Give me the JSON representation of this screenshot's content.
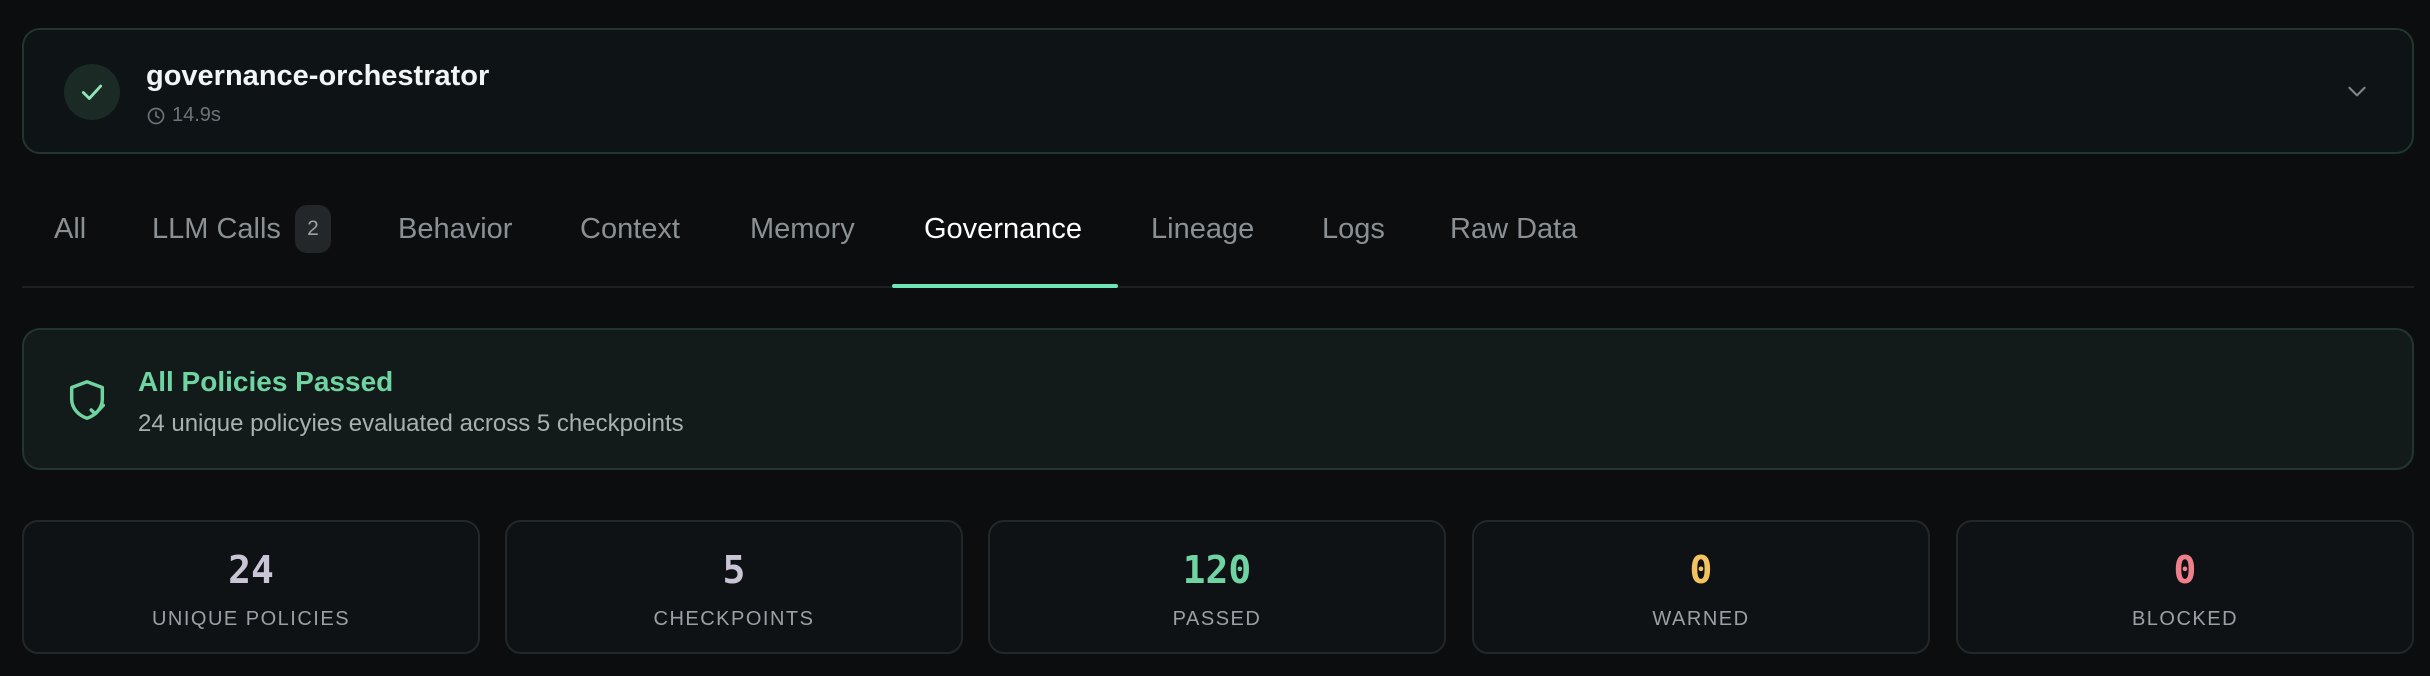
{
  "run": {
    "name": "governance-orchestrator",
    "duration": "14.9s",
    "status_icon": "check-icon"
  },
  "tabs": [
    {
      "label": "All"
    },
    {
      "label": "LLM Calls",
      "badge": "2"
    },
    {
      "label": "Behavior"
    },
    {
      "label": "Context"
    },
    {
      "label": "Memory"
    },
    {
      "label": "Governance",
      "active": true
    },
    {
      "label": "Lineage"
    },
    {
      "label": "Logs"
    },
    {
      "label": "Raw Data"
    }
  ],
  "banner": {
    "title": "All Policies Passed",
    "subtitle": "24 unique policyies evaluated across 5 checkpoints",
    "icon": "shield-check-icon"
  },
  "stats": [
    {
      "value": "24",
      "label": "UNIQUE POLICIES",
      "color": "#c9c4d6"
    },
    {
      "value": "5",
      "label": "CHECKPOINTS",
      "color": "#c9c4d6"
    },
    {
      "value": "120",
      "label": "PASSED",
      "color": "#6fd3a2"
    },
    {
      "value": "0",
      "label": "WARNED",
      "color": "#f2c35e"
    },
    {
      "value": "0",
      "label": "BLOCKED",
      "color": "#f07f8c"
    }
  ],
  "colors": {
    "accent": "#6ee7b7",
    "success": "#6fd3a2"
  }
}
